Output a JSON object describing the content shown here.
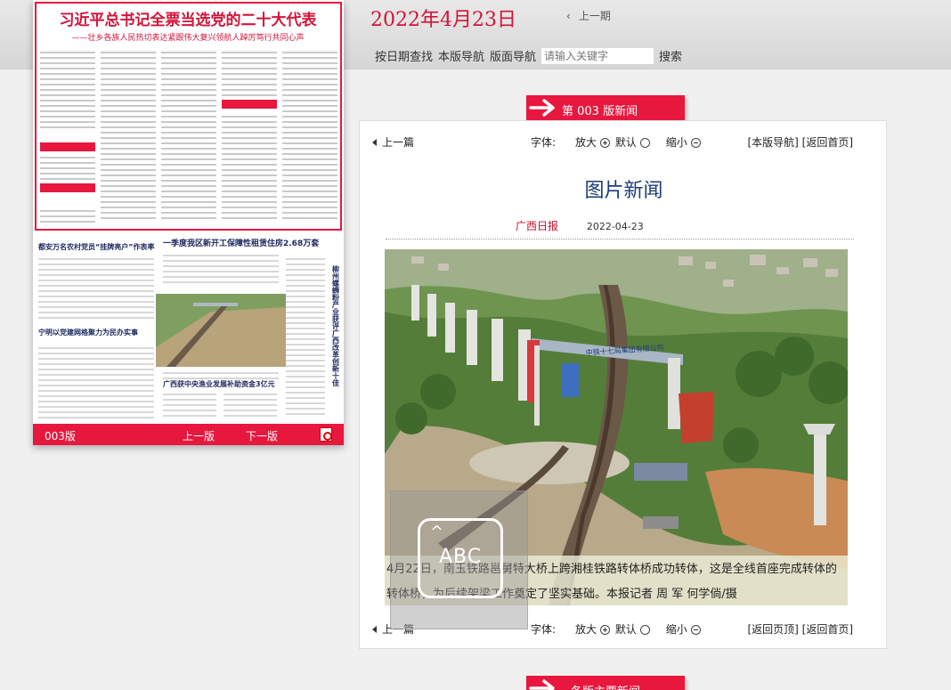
{
  "header": {
    "date_title": "2022年4月23日",
    "prev_period": "上一期",
    "nav_date_search": "按日期查找",
    "nav_page_nav": "本版导航",
    "nav_layout_nav": "版面导航",
    "search_placeholder": "请输入关键字",
    "search_button": "搜索"
  },
  "paper": {
    "page_label": "003版",
    "prev_label": "上一版",
    "next_label": "下一版",
    "headline_main": "习近平总书记全票当选党的二十大代表",
    "headline_sub": "——壮乡各族人民热切表达紧跟伟大复兴领航人踔厉笃行共同心声",
    "headline_a": "都安万名农村党员“挂牌亮户”作表率",
    "headline_b": "一季度我区新开工保障性租赁住房2.68万套",
    "headline_c": "宁明以党建网格聚力为民办实事",
    "headline_d": "广西获中央渔业发展补助资金3亿元",
    "headline_e": "柳州螺蛳粉产业获评广西改革创新十佳"
  },
  "section_tab": {
    "label": "第  003  版新闻"
  },
  "bottom_tab": {
    "label": "各版主要新闻"
  },
  "article": {
    "prev_label": "上一篇",
    "font_label": "字体:",
    "font_larger": "放大",
    "font_default": "默认",
    "font_smaller": "缩小",
    "top_links": "[本版导航] [返回首页]",
    "bottom_links": "[返回页顶] [返回首页]",
    "title": "图片新闻",
    "source": "广西日报",
    "date": "2022-04-23",
    "caption": "4月22日，南玉铁路邕舅特大桥上跨湘桂铁路转体桥成功转体，这是全线首座完成转体的转体桥，为后续架梁工作奠定了坚实基础。本报记者 周 军 何学倘/摄",
    "bridge_sign": "中铁十七局集团有限公司"
  },
  "overlay": {
    "button_text": "ABC"
  },
  "colors": {
    "accent_red": "#e8173e",
    "title_blue": "#1e3c78",
    "date_red": "#d2143a"
  }
}
